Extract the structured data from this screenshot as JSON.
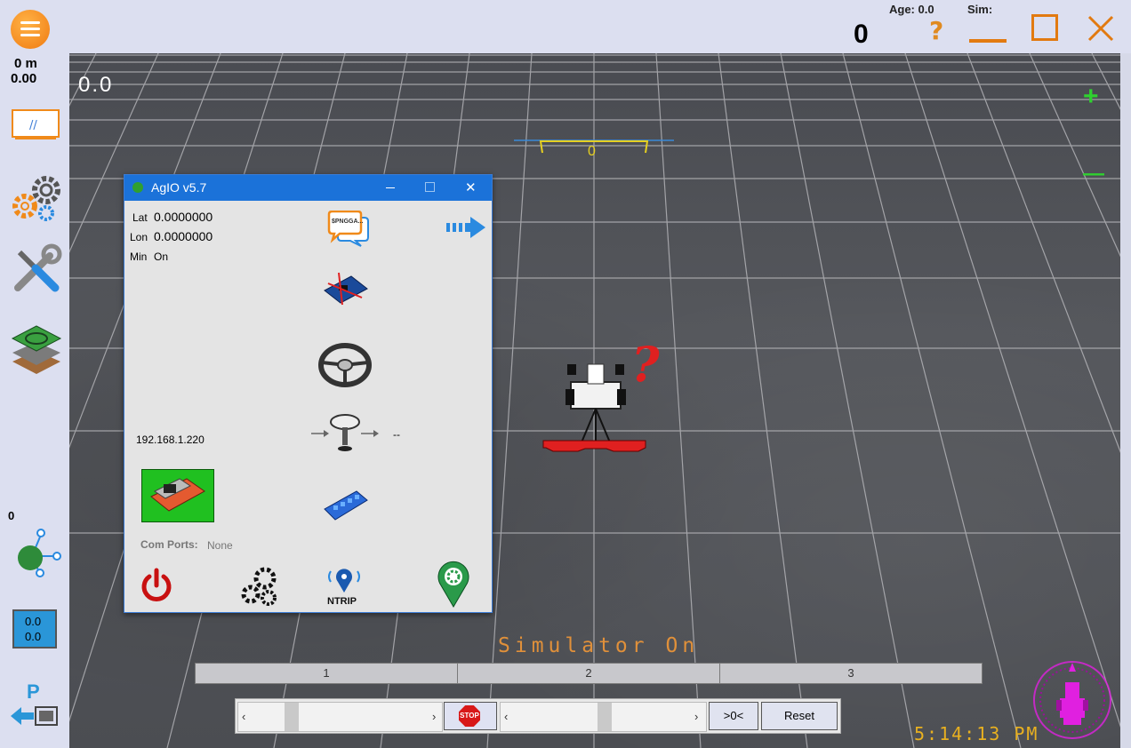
{
  "topbar": {
    "age_label": "Age: 0.0",
    "sim_label": "Sim:",
    "counter": "0",
    "help_icon": "question-icon",
    "minimize_icon": "minimize-icon",
    "maximize_icon": "maximize-icon",
    "close_icon": "close-icon"
  },
  "sidebar": {
    "distance": "0 m",
    "distance_value": "0.00",
    "mid_value": "0",
    "box_top": "0.0",
    "box_bottom": "0.0",
    "p_label": "P"
  },
  "field": {
    "speed_readout": "0.0",
    "lightbar_value": "0",
    "plus_label": "+",
    "minus_label": "—",
    "question_mark": "?",
    "simulator_status": "Simulator On",
    "clock": "5:14:13 PM"
  },
  "agio": {
    "title": "AgIO v5.7",
    "lat_label": "Lat",
    "lat_value": "0.0000000",
    "lon_label": "Lon",
    "lon_value": "0.0000000",
    "min_label": "Min",
    "min_value": "On",
    "ip": "192.168.1.220",
    "com_ports_label": "Com Ports:",
    "com_ports_value": "None",
    "gps_rate": "--",
    "nmea_badge": "$PNGGA...",
    "ntrip_label": "NTRIP"
  },
  "sections": [
    "1",
    "2",
    "3"
  ],
  "controls": {
    "left_arrow": "‹",
    "right_arrow": "›",
    "stop_label": "STOP",
    "zero_label": ">0<",
    "reset_label": "Reset"
  },
  "colors": {
    "accent_orange": "#f07a10",
    "agio_title_blue": "#1b72d9",
    "sim_text": "#e0903a",
    "clock_text": "#e8b020",
    "lightbar_yellow": "#e6d020",
    "boom_red": "#e02020",
    "compass_magenta": "#e020e0"
  }
}
